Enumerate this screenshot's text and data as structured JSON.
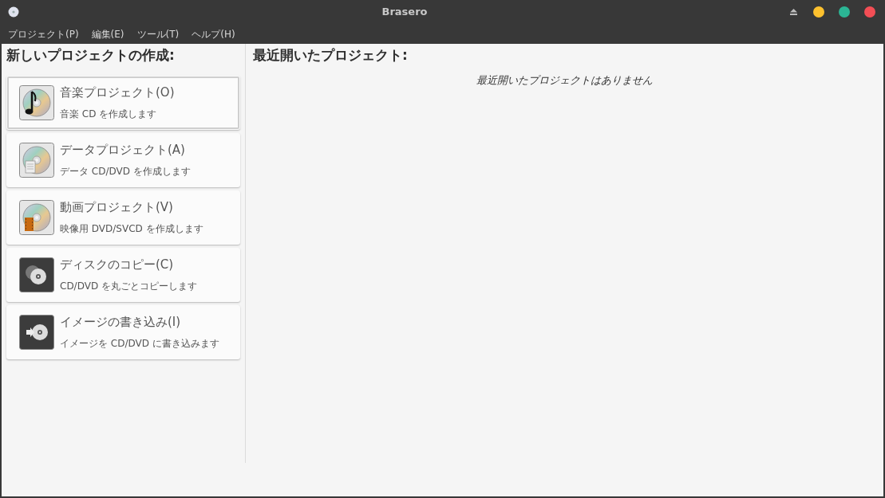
{
  "window": {
    "title": "Brasero"
  },
  "menu": [
    "プロジェクト(P)",
    "編集(E)",
    "ツール(T)",
    "ヘルプ(H)"
  ],
  "new_project": {
    "heading": "新しいプロジェクトの作成:",
    "items": [
      {
        "kind": "audio",
        "title": "音楽プロジェクト(O)",
        "description": "音楽 CD を作成します",
        "selected": true
      },
      {
        "kind": "data",
        "title": "データプロジェクト(A)",
        "description": "データ CD/DVD を作成します",
        "selected": false
      },
      {
        "kind": "video",
        "title": "動画プロジェクト(V)",
        "description": "映像用 DVD/SVCD を作成します",
        "selected": false
      },
      {
        "kind": "copy",
        "title": "ディスクのコピー(C)",
        "description": "CD/DVD を丸ごとコピーします",
        "selected": false
      },
      {
        "kind": "burn",
        "title": "イメージの書き込み(I)",
        "description": "イメージを CD/DVD に書き込みます",
        "selected": false
      }
    ]
  },
  "recent": {
    "heading": "最近開いたプロジェクト:",
    "empty_message": "最近開いたプロジェクトはありません"
  }
}
